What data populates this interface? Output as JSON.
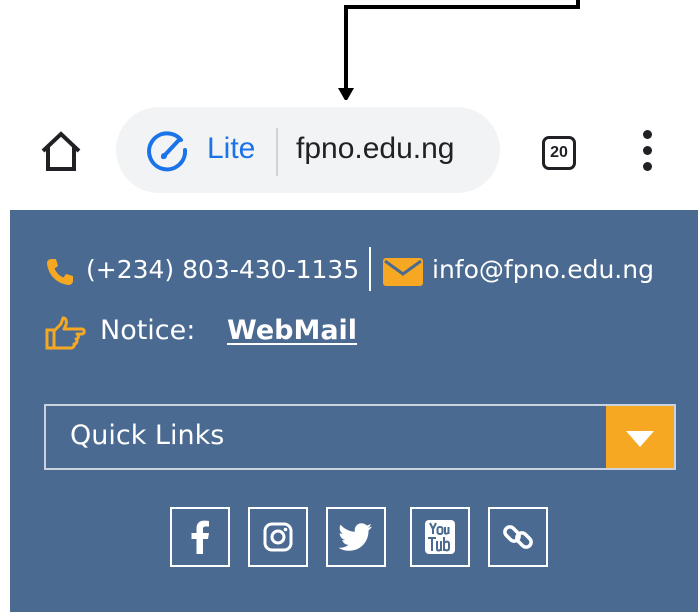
{
  "browser": {
    "mode_label": "Lite",
    "url": "fpno.edu.ng",
    "tab_count": "20"
  },
  "header": {
    "phone": "(+234) 803-430-1135",
    "email": "info@fpno.edu.ng",
    "notice_label": "Notice:",
    "notice_link": "WebMail",
    "quick_links_label": "Quick Links"
  },
  "social": [
    "facebook-icon",
    "instagram-icon",
    "twitter-icon",
    "youtube-icon",
    "link-icon"
  ],
  "colors": {
    "site_bg": "#4a6a92",
    "accent": "#f7a823",
    "lite_blue": "#1a73e8",
    "omnibox_bg": "#f1f3f4"
  }
}
